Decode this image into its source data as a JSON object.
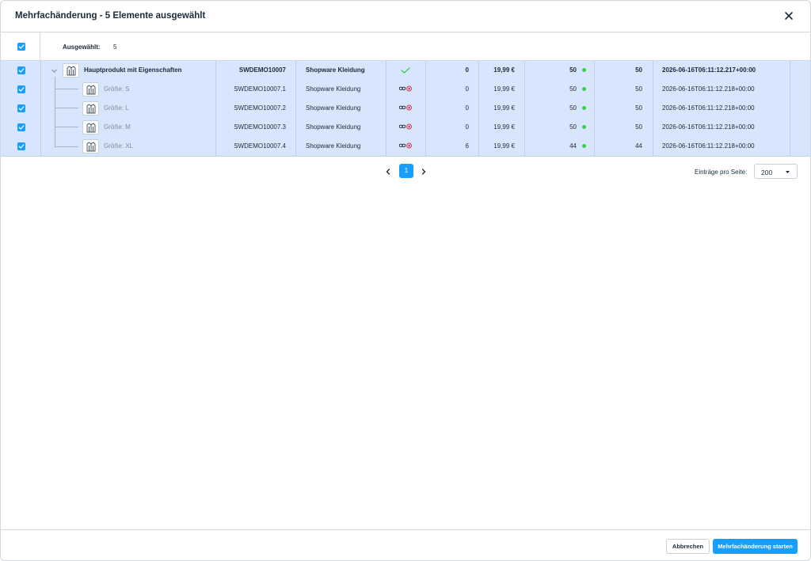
{
  "modal": {
    "title": "Mehrfachänderung - 5 Elemente ausgewählt"
  },
  "selection": {
    "label": "Ausgewählt:",
    "count": "5"
  },
  "rows": [
    {
      "name": "Hauptprodukt mit Eigenschaften",
      "number": "SWDEMO10007",
      "manufacturer": "Shopware Kleidung",
      "active": "check",
      "stock_a": "0",
      "price": "19,99 €",
      "stock": "50",
      "available": "50",
      "date": "2026-06-16T06:11:12.217+00:00"
    },
    {
      "name": "Größe: S",
      "number": "SWDEMO10007.1",
      "manufacturer": "Shopware Kleidung",
      "active": "inherit-off",
      "stock_a": "0",
      "price": "19,99 €",
      "stock": "50",
      "available": "50",
      "date": "2026-06-16T06:11:12.218+00:00"
    },
    {
      "name": "Größe: L",
      "number": "SWDEMO10007.2",
      "manufacturer": "Shopware Kleidung",
      "active": "inherit-off",
      "stock_a": "0",
      "price": "19,99 €",
      "stock": "50",
      "available": "50",
      "date": "2026-06-16T06:11:12.218+00:00"
    },
    {
      "name": "Größe: M",
      "number": "SWDEMO10007.3",
      "manufacturer": "Shopware Kleidung",
      "active": "inherit-off",
      "stock_a": "0",
      "price": "19,99 €",
      "stock": "50",
      "available": "50",
      "date": "2026-06-16T06:11:12.218+00:00"
    },
    {
      "name": "Größe: XL",
      "number": "SWDEMO10007.4",
      "manufacturer": "Shopware Kleidung",
      "active": "inherit-off",
      "stock_a": "6",
      "price": "19,99 €",
      "stock": "44",
      "available": "44",
      "date": "2026-06-16T06:11:12.218+00:00"
    }
  ],
  "pagination": {
    "current_page": "1",
    "per_page_label": "Einträge pro Seite:",
    "per_page_value": "200"
  },
  "footer": {
    "cancel_label": "Abbrechen",
    "start_label": "Mehrfachänderung starten"
  },
  "colors": {
    "accent": "#189eff",
    "selected_row_bg": "#d8e6fd",
    "stock_dot": "#37d046",
    "check_green": "#37d046",
    "inherit_red": "#de294c"
  },
  "icons": [
    "close-icon",
    "checkbox-check-icon",
    "chevron-down-icon",
    "product-jacket-icon",
    "check-icon",
    "inherit-link-icon",
    "inherit-off-icon",
    "chevron-left-icon",
    "chevron-right-icon"
  ]
}
